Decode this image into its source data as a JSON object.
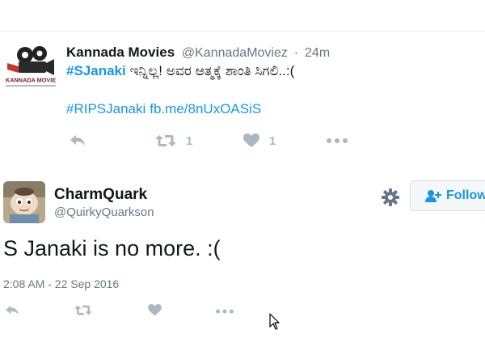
{
  "tweet1": {
    "author_name": "Kannada Movies",
    "handle": "@KannadaMoviez",
    "separator": "·",
    "time": "24m",
    "logo_text": "KANNADA MOVIE",
    "hashtag": "#SJanaki",
    "text_rest": " ಇನ್ನಿಲ್ಲ! ಅವರ ಆತ್ಮಕ್ಕೆ ಶಾಂತಿ ಸಿಗಲಿ..:(",
    "link_hashtag": "#RIPSJanaki",
    "link_url": "fb.me/8nUxOASiS",
    "retweet_count": "1",
    "like_count": "1",
    "icons": [
      "reply-icon",
      "retweet-icon",
      "heart-icon",
      "more-icon"
    ]
  },
  "tweet2": {
    "author_name": "CharmQuark",
    "handle": "@QuirkyQuarkson",
    "text": "S Janaki is no more. :(",
    "timestamp": "2:08 AM - 22 Sep 2016",
    "follow_label": "Follow",
    "icons": [
      "gear-icon",
      "follow-user-icon",
      "reply-icon",
      "retweet-icon",
      "heart-icon",
      "more-icon"
    ]
  },
  "colors": {
    "accent": "#1b95e0",
    "muted": "#657786",
    "action_icon": "#aab8c2",
    "divider": "#e6ecf0"
  }
}
